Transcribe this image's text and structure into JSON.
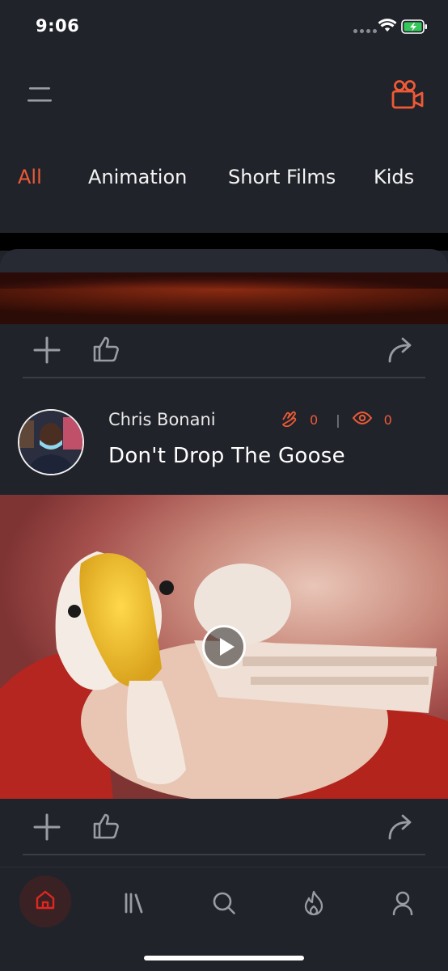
{
  "status_bar": {
    "time": "9:06"
  },
  "header": {
    "menu_icon": "hamburger-menu-icon",
    "camera_icon": "video-camera-icon",
    "accent": "#ee5a36"
  },
  "tabs": [
    {
      "label": "All",
      "active": true
    },
    {
      "label": "Animation",
      "active": false
    },
    {
      "label": "Short Films",
      "active": false
    },
    {
      "label": "Kids",
      "active": false
    }
  ],
  "posts": [
    {
      "actions": {
        "add_icon": "plus-icon",
        "like_icon": "thumbs-up-icon",
        "share_icon": "share-arrow-icon"
      }
    },
    {
      "author": "Chris Bonani",
      "title": "Don't Drop The Goose",
      "claps": "0",
      "views": "0",
      "actions": {
        "add_icon": "plus-icon",
        "like_icon": "thumbs-up-icon",
        "share_icon": "share-arrow-icon"
      }
    }
  ],
  "bottom_nav": [
    {
      "icon": "home-icon",
      "active": true
    },
    {
      "icon": "library-icon",
      "active": false
    },
    {
      "icon": "search-icon",
      "active": false
    },
    {
      "icon": "flame-icon",
      "active": false
    },
    {
      "icon": "profile-icon",
      "active": false
    }
  ],
  "colors": {
    "background": "#21232b",
    "accent": "#ee5a36",
    "active_home": "#e0271f"
  }
}
